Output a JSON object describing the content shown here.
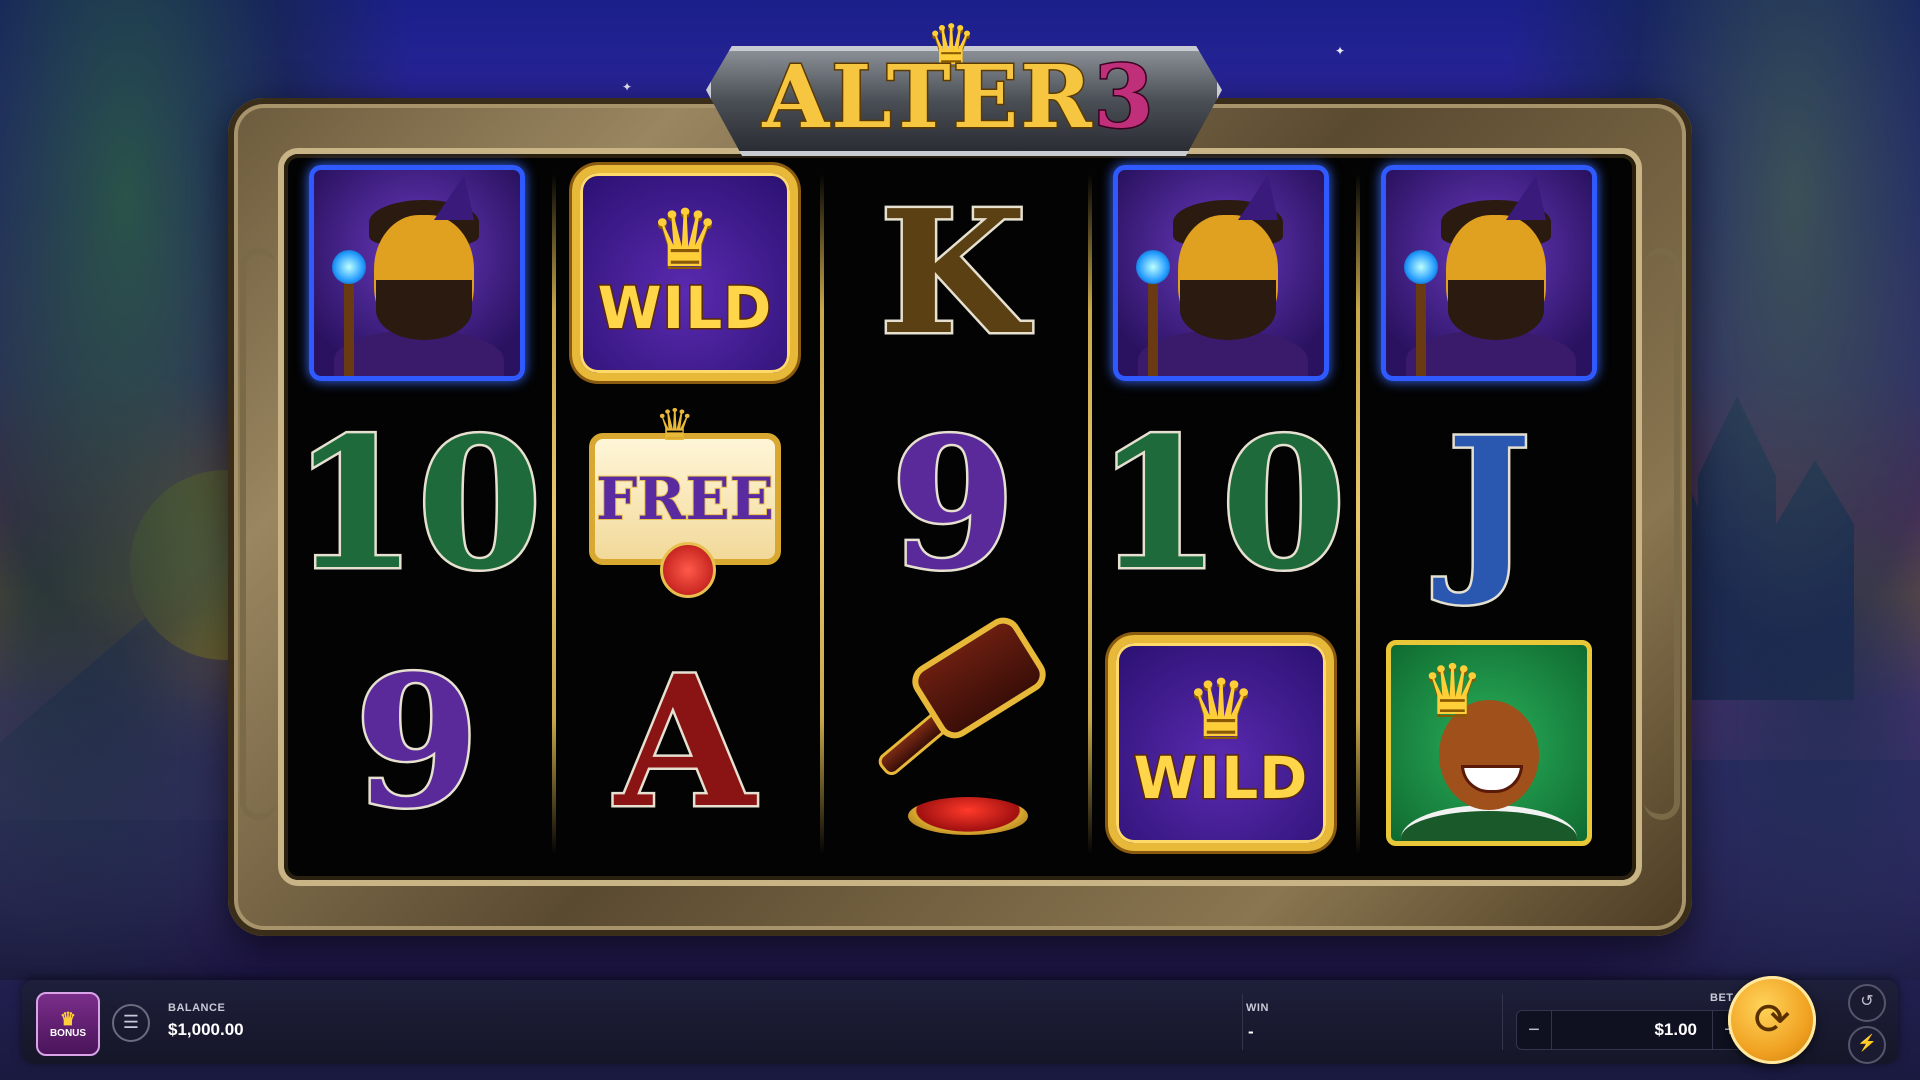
{
  "game": {
    "logo_text": "ALTER",
    "logo_number": "3"
  },
  "reels": [
    [
      "wizard",
      "letter-10",
      "letter-9"
    ],
    [
      "wild",
      "free",
      "letter-A"
    ],
    [
      "letter-K",
      "letter-9",
      "gavel"
    ],
    [
      "wizard",
      "letter-10",
      "wild"
    ],
    [
      "wizard",
      "letter-J",
      "king"
    ]
  ],
  "symbols": {
    "wild_text": "WILD",
    "free_text": "FREE",
    "ten": "10",
    "nine": "9",
    "ace": "A",
    "king": "K",
    "jack": "J"
  },
  "bottom_bar": {
    "bonus_label": "BONUS",
    "balance_label": "BALANCE",
    "balance_value": "$1,000.00",
    "win_label": "WIN",
    "win_value": "-",
    "bet_label": "BET",
    "bet_value": "$1.00",
    "minus": "−",
    "plus": "+"
  },
  "icons": {
    "bonus": "crown-icon",
    "menu": "hamburger-icon",
    "spin": "refresh-icon",
    "history": "history-icon",
    "turbo": "lightning-icon"
  },
  "colors": {
    "spin_button": "#f0a020",
    "wizard_border": "#2f5aff",
    "wild_border": "#e8b838"
  }
}
